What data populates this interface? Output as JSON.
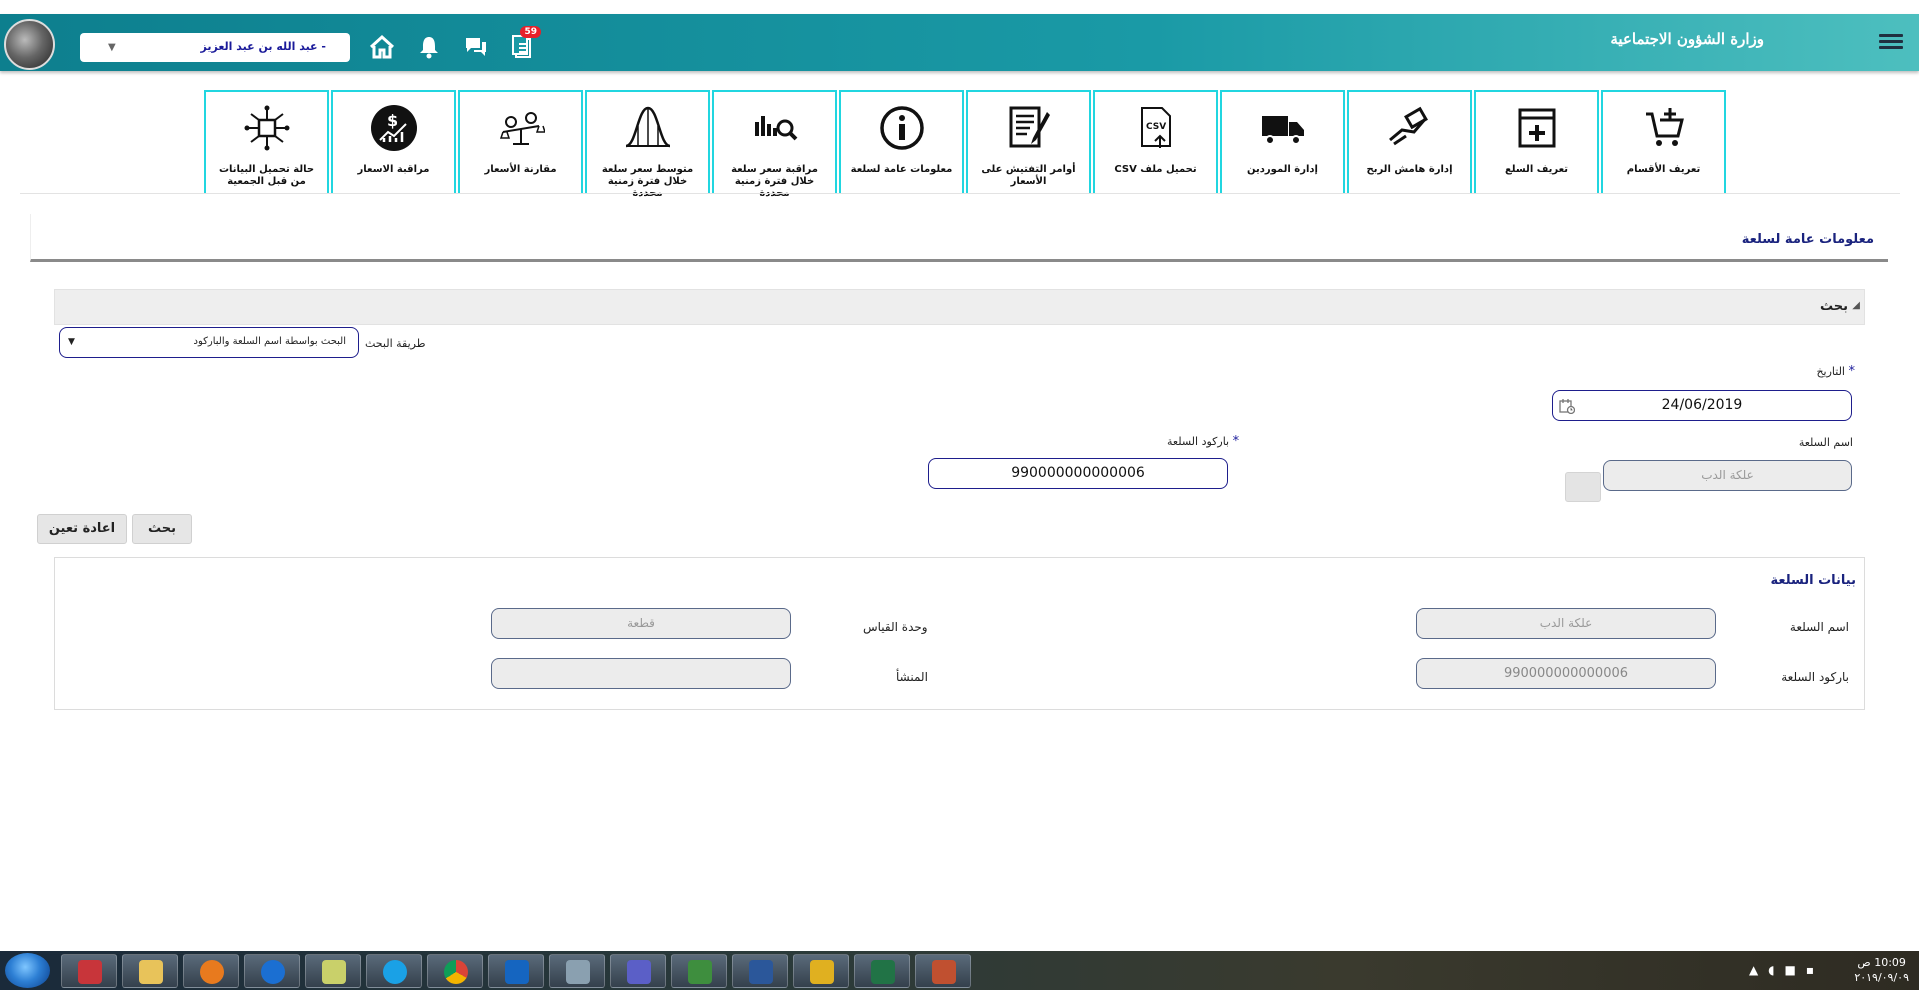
{
  "header": {
    "ministry": "وزارة الشؤون الاجتماعية",
    "user": "عبد الله بن عبد العزيز",
    "user_prefix": "-",
    "notification_count": "59",
    "accent": "#1a9aa6"
  },
  "tiles": [
    {
      "label": "تعريف الأقسام",
      "icon": "cart-add-icon"
    },
    {
      "label": "تعريف السلع",
      "icon": "add-box-icon"
    },
    {
      "label": "إدارة هامش الربح",
      "icon": "hand-money-icon"
    },
    {
      "label": "إدارة الموردين",
      "icon": "truck-icon"
    },
    {
      "label": "تحميل ملف CSV",
      "icon": "csv-upload-icon"
    },
    {
      "label": "أوامر التفتيش على الأسعار",
      "icon": "document-edit-icon"
    },
    {
      "label": "معلومات عامة لسلعة",
      "icon": "info-icon"
    },
    {
      "label": "مراقبة سعر سلعة خلال فترة زمنية محددة",
      "icon": "chart-search-icon"
    },
    {
      "label": "متوسط سعر سلعة خلال فترة زمنية محددة",
      "icon": "bell-curve-icon"
    },
    {
      "label": "مقارنة الأسعار",
      "icon": "scale-icon"
    },
    {
      "label": "مراقبة الاسعار",
      "icon": "dollar-chart-icon"
    },
    {
      "label": "حالة تحميل البيانات من قبل الجمعية",
      "icon": "flow-chart-icon"
    }
  ],
  "page": {
    "title": "معلومات عامة لسلعة"
  },
  "search": {
    "panel_title": "بحث",
    "method_label": "طريقة البحث",
    "method_value": "البحث بواسطة اسم السلعة والباركود",
    "date_label": "التاريخ",
    "date_value": "24/06/2019",
    "name_label": "اسم السلعة",
    "name_value": "علكة الدب",
    "barcode_label": "باركود السلعة",
    "barcode_value": "990000000000006",
    "search_button": "بحث",
    "reset_button": "اعادة تعين"
  },
  "item_data": {
    "title": "بيانات السلعة",
    "name_label": "اسم السلعة",
    "name_value": "علكة الدب",
    "unit_label": "وحدة القياس",
    "unit_value": "قطعة",
    "barcode_label": "باركود السلعة",
    "barcode_value": "990000000000006",
    "origin_label": "المنشأ",
    "origin_value": ""
  },
  "taskbar": {
    "time": "10:09 ص",
    "date": "٢٠١٩/٠٩/٠٩"
  }
}
